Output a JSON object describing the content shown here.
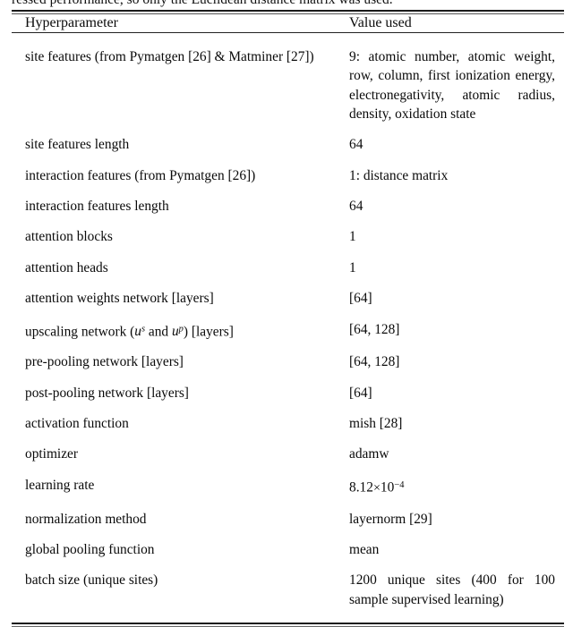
{
  "page": {
    "truncated_paragraph_line": "ressed performance, so only the Euclidean distance matrix was used."
  },
  "table": {
    "headers": {
      "col1": "Hyperparameter",
      "col2": "Value used"
    },
    "rows": [
      {
        "hyperparameter": "site features (from Pymatgen [26] & Matminer [27])",
        "value": "9: atomic number, atomic weight, row, column, first ionization energy, electronegativity, atomic radius, density, oxidation state"
      },
      {
        "hyperparameter": "site features length",
        "value": "64"
      },
      {
        "hyperparameter": "interaction features (from Pymatgen [26])",
        "value": "1: distance matrix"
      },
      {
        "hyperparameter": "interaction features length",
        "value": "64"
      },
      {
        "hyperparameter": "attention blocks",
        "value": "1"
      },
      {
        "hyperparameter": "attention heads",
        "value": "1"
      },
      {
        "hyperparameter": "attention weights network [layers]",
        "value": "[64]"
      },
      {
        "hyperparameter_prefix": "upscaling network (",
        "hyperparameter_math_1": "u",
        "hyperparameter_math_1_sup": "s",
        "hyperparameter_mid": " and ",
        "hyperparameter_math_2": "u",
        "hyperparameter_math_2_sup": "p",
        "hyperparameter_suffix": ") [layers]",
        "hyperparameter": "upscaling network (u^s and u^p) [layers]",
        "value": "[64, 128]"
      },
      {
        "hyperparameter": "pre-pooling network [layers]",
        "value": "[64, 128]"
      },
      {
        "hyperparameter": "post-pooling network [layers]",
        "value": "[64]"
      },
      {
        "hyperparameter": "activation function",
        "value": "mish [28]"
      },
      {
        "hyperparameter": "optimizer",
        "value": "adamw"
      },
      {
        "hyperparameter": "learning rate",
        "value_mantissa": "8.12",
        "value_times": "×",
        "value_base": "10",
        "value_exponent": "−4",
        "value": "8.12×10−4"
      },
      {
        "hyperparameter": "normalization method",
        "value": "layernorm [29]"
      },
      {
        "hyperparameter": "global pooling function",
        "value": "mean"
      },
      {
        "hyperparameter": "batch size (unique sites)",
        "value": "1200 unique sites (400 for 100 sample supervised learning)"
      }
    ]
  }
}
